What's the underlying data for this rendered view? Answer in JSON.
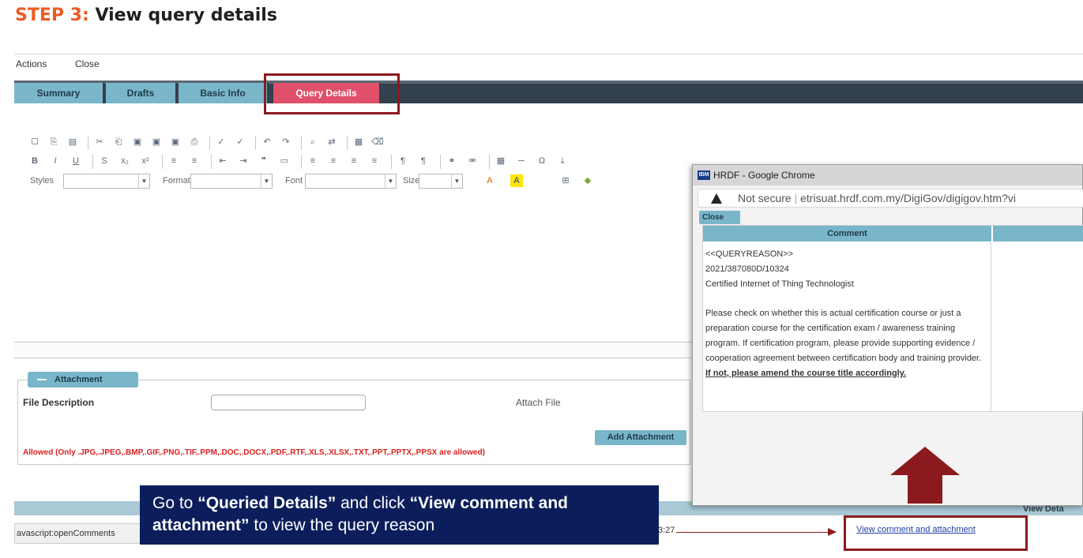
{
  "step": {
    "label": "STEP 3:",
    "title": "View query details"
  },
  "menubar": {
    "actions": "Actions",
    "close": "Close"
  },
  "tabs": [
    {
      "label": "Summary"
    },
    {
      "label": "Drafts"
    },
    {
      "label": "Basic Info"
    },
    {
      "label": "Query Details",
      "active": true
    }
  ],
  "editor": {
    "styles_label": "Styles",
    "format_label": "Format",
    "font_label": "Font",
    "size_label": "Size",
    "icons_row1": [
      "new-page-icon",
      "preview-icon",
      "templates-icon",
      "cut-icon",
      "copy-icon",
      "paste-icon",
      "paste-text-icon",
      "paste-word-icon",
      "print-icon",
      "spellcheck-icon",
      "spellcheck-as-you-type-icon",
      "undo-icon",
      "redo-icon",
      "find-icon",
      "replace-icon",
      "select-all-icon",
      "remove-format-icon"
    ],
    "icons_row2": [
      "bold-icon",
      "italic-icon",
      "underline-icon",
      "strike-icon",
      "subscript-icon",
      "superscript-icon",
      "numbered-list-icon",
      "bulleted-list-icon",
      "outdent-icon",
      "indent-icon",
      "blockquote-icon",
      "div-icon",
      "align-left-icon",
      "align-center-icon",
      "align-right-icon",
      "justify-icon",
      "ltr-icon",
      "rtl-icon",
      "link-icon",
      "unlink-icon",
      "table-icon",
      "horizontal-rule-icon",
      "special-char-icon",
      "page-break-icon"
    ]
  },
  "attachment": {
    "title": "Attachment",
    "file_description_label": "File Description",
    "attach_file_label": "Attach File",
    "add_button": "Add Attachment",
    "allowed_text": "Allowed (Only .JPG,.JPEG,.BMP,.GIF,.PNG,.TIF,.PPM,.DOC,.DOCX,.PDF,.RTF,.XLS,.XLSX,.TXT,.PPT,.PPTX,.PPSX are allowed)"
  },
  "status": {
    "url": "avascript:openComments",
    "time_fragment": "3:27",
    "view_detail_header": "View Deta",
    "view_link": "View comment and attachment"
  },
  "callout": {
    "part1": "Go to ",
    "bold1": "“Queried Details”",
    "part2": " and click ",
    "bold2": "“View comment and attachment”",
    "part3": " to view the query reason"
  },
  "popup": {
    "window_title": "HRDF - Google Chrome",
    "logo_text": "IBM",
    "security": "Not secure",
    "url": "etrisuat.hrdf.com.my/DigiGov/digigov.htm?vi",
    "close_button": "Close",
    "comment_header": "Comment",
    "comment_lines": [
      "<<QUERYREASON>>",
      "2021/387080D/10324",
      "Certified Internet of Thing Technologist"
    ],
    "comment_para": "Please check on whether this is actual certification course or just a preparation course for the certification exam / awareness training program. If certification program, please provide supporting evidence / cooperation agreement between certification body and training provider. ",
    "comment_emphasis": "If not, please amend the course title accordingly."
  },
  "colors": {
    "accent_orange": "#ee5a24",
    "tab_teal": "#7ab6c9",
    "tab_active": "#e0506a",
    "highlight_red": "#8b1a1f",
    "callout_navy": "#0b1e5b",
    "allowed_red": "#d8221f"
  }
}
